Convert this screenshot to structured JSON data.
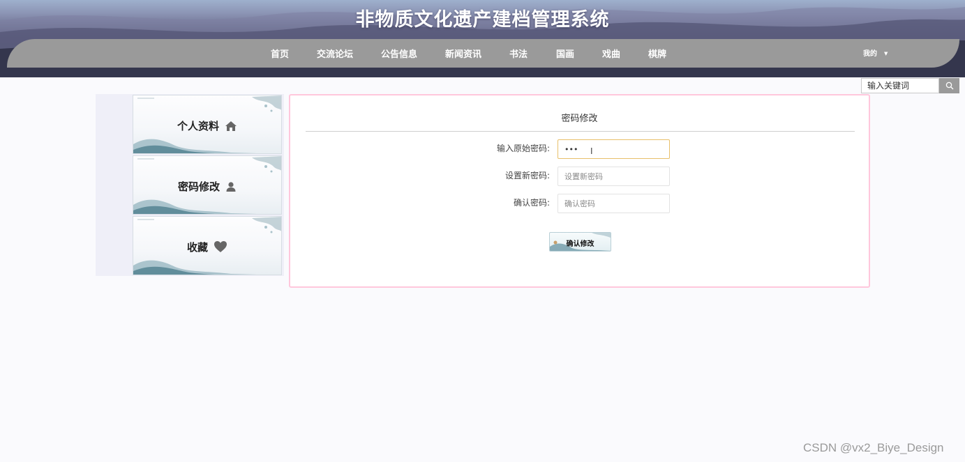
{
  "header": {
    "site_title": "非物质文化遗产建档管理系统",
    "nav": [
      "首页",
      "交流论坛",
      "公告信息",
      "新闻资讯",
      "书法",
      "国画",
      "戏曲",
      "棋牌"
    ],
    "user_menu_label": "我的",
    "caret_icon": "caret-down-icon"
  },
  "search": {
    "placeholder": "输入关键词",
    "icon": "search-icon"
  },
  "sidebar": {
    "items": [
      {
        "label": "个人资料",
        "icon": "home-icon"
      },
      {
        "label": "密码修改",
        "icon": "user-icon"
      },
      {
        "label": "收藏",
        "icon": "heart-icon"
      }
    ]
  },
  "form": {
    "title": "密码修改",
    "fields": [
      {
        "label": "输入原始密码:",
        "value": "•••",
        "placeholder": ""
      },
      {
        "label": "设置新密码:",
        "value": "",
        "placeholder": "设置新密码"
      },
      {
        "label": "确认密码:",
        "value": "",
        "placeholder": "确认密码"
      }
    ],
    "submit_label": "确认修改"
  },
  "watermark": "CSDN @vx2_Biye_Design",
  "colors": {
    "nav_band": "#9a9a9a",
    "panel_border": "#ffc7dc",
    "active_input_border": "#e8c06a",
    "sidebar_bg": "#efeff8"
  }
}
